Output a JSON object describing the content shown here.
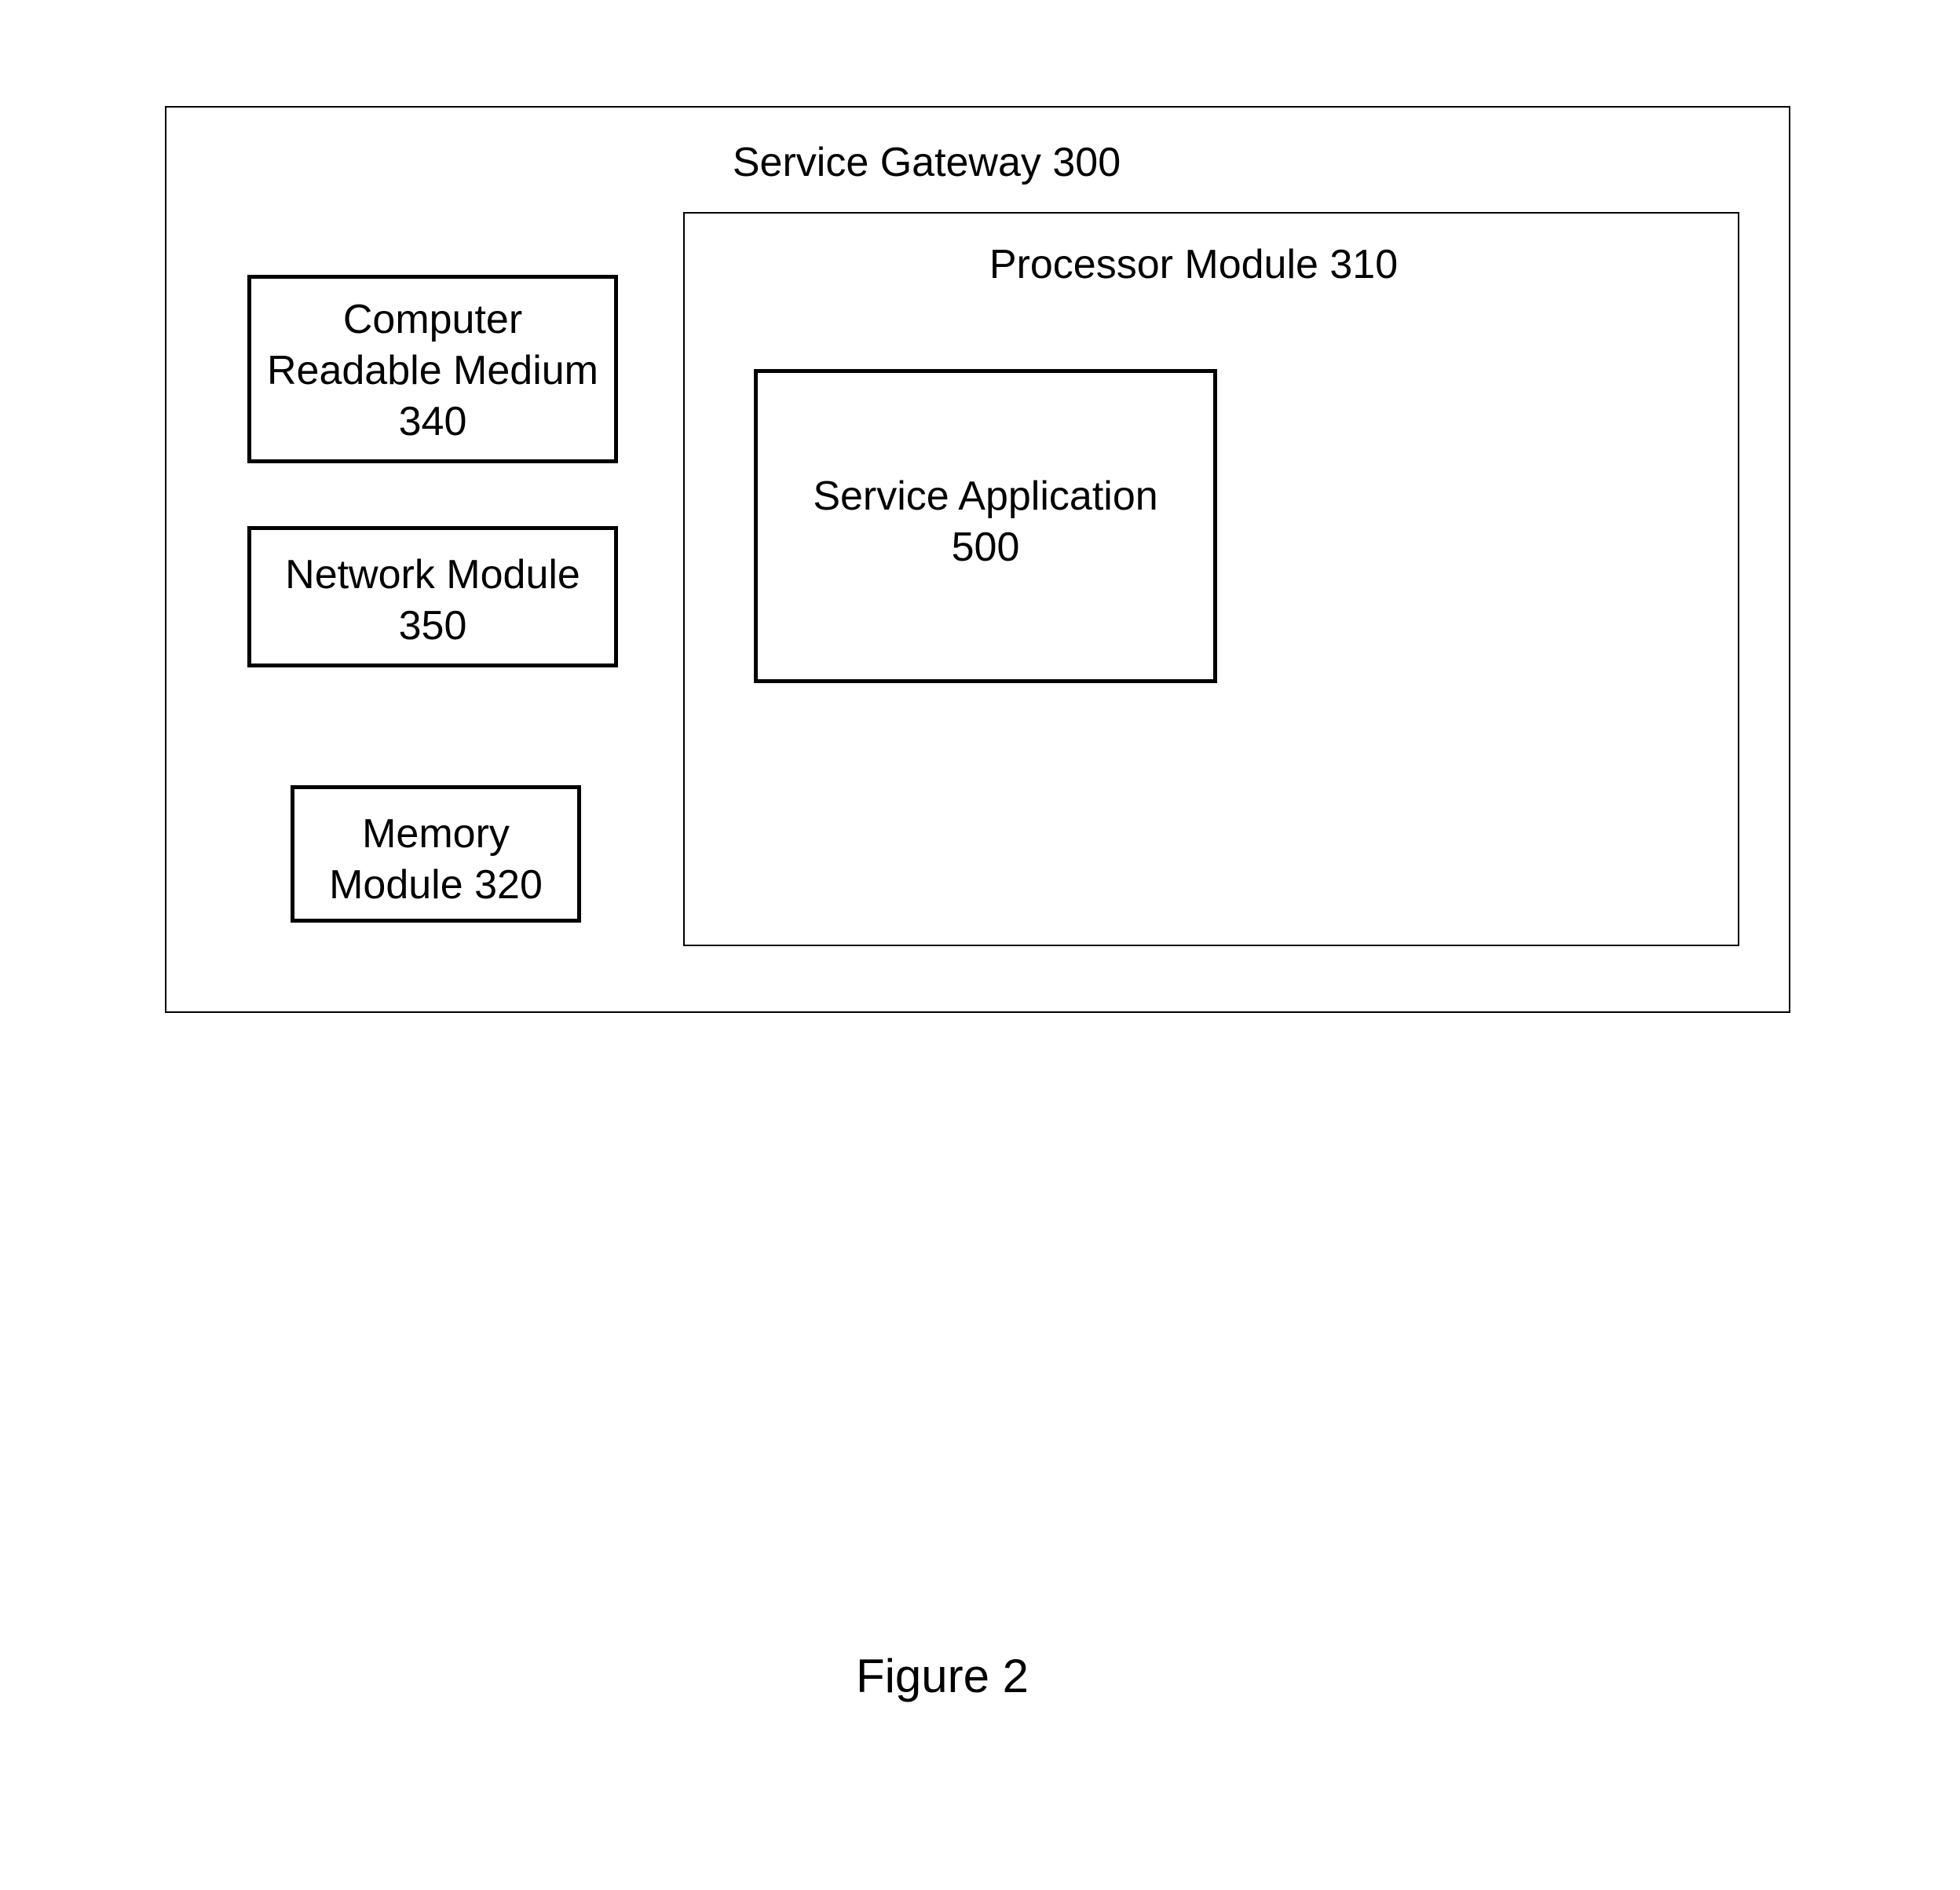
{
  "gateway": {
    "title": "Service Gateway 300",
    "left": {
      "computer_readable_medium": "Computer\nReadable Medium\n340",
      "network_module": "Network Module\n350",
      "memory_module": "Memory\nModule 320"
    },
    "processor": {
      "title": "Processor Module 310",
      "service_application": "Service Application\n500"
    }
  },
  "caption": "Figure 2"
}
